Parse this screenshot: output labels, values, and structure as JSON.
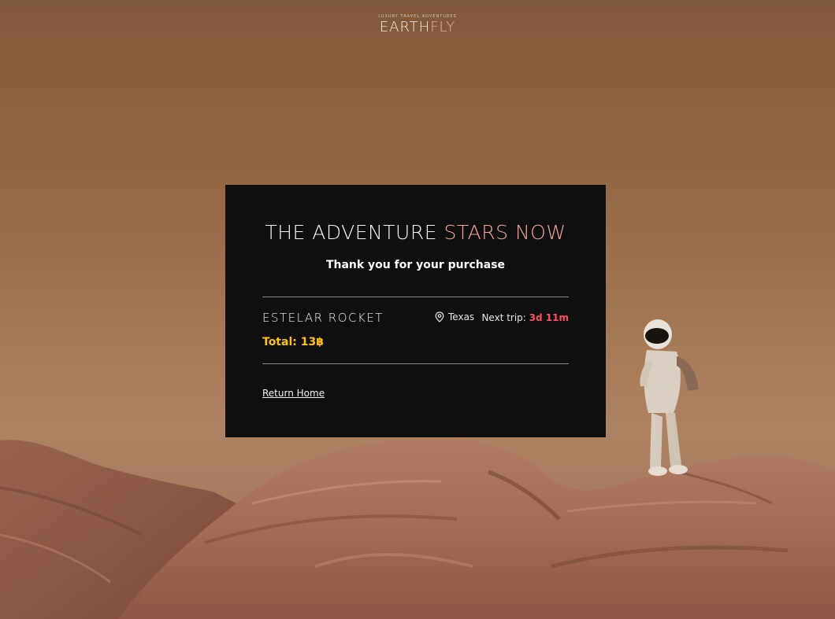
{
  "header": {
    "logo_tagline": "LUXURY TRAVEL ADVENTURES",
    "logo_part_1": "EARTH",
    "logo_part_2": "FLY"
  },
  "card": {
    "headline_part_1": "THE ADVENTURE",
    "headline_part_2": "STARS NOW",
    "subtitle": "Thank you for your purchase",
    "product_name": "ESTELAR ROCKET",
    "location_icon": "map-pin-icon",
    "location": "Texas",
    "next_trip_label": "Next trip:",
    "next_trip_value": "3d 11m",
    "total": "Total: 13฿",
    "return_link": "Return Home"
  },
  "colors": {
    "card_background": "#0f0f10",
    "accent_pink": "#f2a79d",
    "next_trip_red": "#ff4f5e",
    "total_yellow": "#ffc400"
  }
}
